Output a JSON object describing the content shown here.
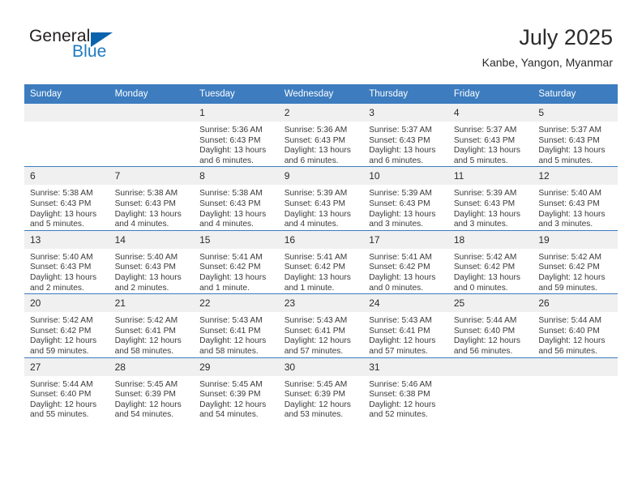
{
  "logo": {
    "word_top": "General",
    "word_bottom": "Blue",
    "triangle_color": "#0a63ad",
    "blue_text_color": "#1f7bc1"
  },
  "header": {
    "title": "July 2025",
    "subtitle": "Kanbe, Yangon, Myanmar"
  },
  "theme": {
    "header_blue": "#3c7cbf",
    "daynum_band": "#f0f0f0",
    "text_color": "#3a3a3a"
  },
  "weekdays": [
    "Sunday",
    "Monday",
    "Tuesday",
    "Wednesday",
    "Thursday",
    "Friday",
    "Saturday"
  ],
  "weeks": [
    [
      {
        "day": "",
        "sunrise": "",
        "sunset": "",
        "daylight": "",
        "empty": true
      },
      {
        "day": "",
        "sunrise": "",
        "sunset": "",
        "daylight": "",
        "empty": true
      },
      {
        "day": "1",
        "sunrise": "Sunrise: 5:36 AM",
        "sunset": "Sunset: 6:43 PM",
        "daylight": "Daylight: 13 hours and 6 minutes."
      },
      {
        "day": "2",
        "sunrise": "Sunrise: 5:36 AM",
        "sunset": "Sunset: 6:43 PM",
        "daylight": "Daylight: 13 hours and 6 minutes."
      },
      {
        "day": "3",
        "sunrise": "Sunrise: 5:37 AM",
        "sunset": "Sunset: 6:43 PM",
        "daylight": "Daylight: 13 hours and 6 minutes."
      },
      {
        "day": "4",
        "sunrise": "Sunrise: 5:37 AM",
        "sunset": "Sunset: 6:43 PM",
        "daylight": "Daylight: 13 hours and 5 minutes."
      },
      {
        "day": "5",
        "sunrise": "Sunrise: 5:37 AM",
        "sunset": "Sunset: 6:43 PM",
        "daylight": "Daylight: 13 hours and 5 minutes."
      }
    ],
    [
      {
        "day": "6",
        "sunrise": "Sunrise: 5:38 AM",
        "sunset": "Sunset: 6:43 PM",
        "daylight": "Daylight: 13 hours and 5 minutes."
      },
      {
        "day": "7",
        "sunrise": "Sunrise: 5:38 AM",
        "sunset": "Sunset: 6:43 PM",
        "daylight": "Daylight: 13 hours and 4 minutes."
      },
      {
        "day": "8",
        "sunrise": "Sunrise: 5:38 AM",
        "sunset": "Sunset: 6:43 PM",
        "daylight": "Daylight: 13 hours and 4 minutes."
      },
      {
        "day": "9",
        "sunrise": "Sunrise: 5:39 AM",
        "sunset": "Sunset: 6:43 PM",
        "daylight": "Daylight: 13 hours and 4 minutes."
      },
      {
        "day": "10",
        "sunrise": "Sunrise: 5:39 AM",
        "sunset": "Sunset: 6:43 PM",
        "daylight": "Daylight: 13 hours and 3 minutes."
      },
      {
        "day": "11",
        "sunrise": "Sunrise: 5:39 AM",
        "sunset": "Sunset: 6:43 PM",
        "daylight": "Daylight: 13 hours and 3 minutes."
      },
      {
        "day": "12",
        "sunrise": "Sunrise: 5:40 AM",
        "sunset": "Sunset: 6:43 PM",
        "daylight": "Daylight: 13 hours and 3 minutes."
      }
    ],
    [
      {
        "day": "13",
        "sunrise": "Sunrise: 5:40 AM",
        "sunset": "Sunset: 6:43 PM",
        "daylight": "Daylight: 13 hours and 2 minutes."
      },
      {
        "day": "14",
        "sunrise": "Sunrise: 5:40 AM",
        "sunset": "Sunset: 6:43 PM",
        "daylight": "Daylight: 13 hours and 2 minutes."
      },
      {
        "day": "15",
        "sunrise": "Sunrise: 5:41 AM",
        "sunset": "Sunset: 6:42 PM",
        "daylight": "Daylight: 13 hours and 1 minute."
      },
      {
        "day": "16",
        "sunrise": "Sunrise: 5:41 AM",
        "sunset": "Sunset: 6:42 PM",
        "daylight": "Daylight: 13 hours and 1 minute."
      },
      {
        "day": "17",
        "sunrise": "Sunrise: 5:41 AM",
        "sunset": "Sunset: 6:42 PM",
        "daylight": "Daylight: 13 hours and 0 minutes."
      },
      {
        "day": "18",
        "sunrise": "Sunrise: 5:42 AM",
        "sunset": "Sunset: 6:42 PM",
        "daylight": "Daylight: 13 hours and 0 minutes."
      },
      {
        "day": "19",
        "sunrise": "Sunrise: 5:42 AM",
        "sunset": "Sunset: 6:42 PM",
        "daylight": "Daylight: 12 hours and 59 minutes."
      }
    ],
    [
      {
        "day": "20",
        "sunrise": "Sunrise: 5:42 AM",
        "sunset": "Sunset: 6:42 PM",
        "daylight": "Daylight: 12 hours and 59 minutes."
      },
      {
        "day": "21",
        "sunrise": "Sunrise: 5:42 AM",
        "sunset": "Sunset: 6:41 PM",
        "daylight": "Daylight: 12 hours and 58 minutes."
      },
      {
        "day": "22",
        "sunrise": "Sunrise: 5:43 AM",
        "sunset": "Sunset: 6:41 PM",
        "daylight": "Daylight: 12 hours and 58 minutes."
      },
      {
        "day": "23",
        "sunrise": "Sunrise: 5:43 AM",
        "sunset": "Sunset: 6:41 PM",
        "daylight": "Daylight: 12 hours and 57 minutes."
      },
      {
        "day": "24",
        "sunrise": "Sunrise: 5:43 AM",
        "sunset": "Sunset: 6:41 PM",
        "daylight": "Daylight: 12 hours and 57 minutes."
      },
      {
        "day": "25",
        "sunrise": "Sunrise: 5:44 AM",
        "sunset": "Sunset: 6:40 PM",
        "daylight": "Daylight: 12 hours and 56 minutes."
      },
      {
        "day": "26",
        "sunrise": "Sunrise: 5:44 AM",
        "sunset": "Sunset: 6:40 PM",
        "daylight": "Daylight: 12 hours and 56 minutes."
      }
    ],
    [
      {
        "day": "27",
        "sunrise": "Sunrise: 5:44 AM",
        "sunset": "Sunset: 6:40 PM",
        "daylight": "Daylight: 12 hours and 55 minutes."
      },
      {
        "day": "28",
        "sunrise": "Sunrise: 5:45 AM",
        "sunset": "Sunset: 6:39 PM",
        "daylight": "Daylight: 12 hours and 54 minutes."
      },
      {
        "day": "29",
        "sunrise": "Sunrise: 5:45 AM",
        "sunset": "Sunset: 6:39 PM",
        "daylight": "Daylight: 12 hours and 54 minutes."
      },
      {
        "day": "30",
        "sunrise": "Sunrise: 5:45 AM",
        "sunset": "Sunset: 6:39 PM",
        "daylight": "Daylight: 12 hours and 53 minutes."
      },
      {
        "day": "31",
        "sunrise": "Sunrise: 5:46 AM",
        "sunset": "Sunset: 6:38 PM",
        "daylight": "Daylight: 12 hours and 52 minutes."
      },
      {
        "day": "",
        "sunrise": "",
        "sunset": "",
        "daylight": "",
        "empty": true
      },
      {
        "day": "",
        "sunrise": "",
        "sunset": "",
        "daylight": "",
        "empty": true
      }
    ]
  ]
}
